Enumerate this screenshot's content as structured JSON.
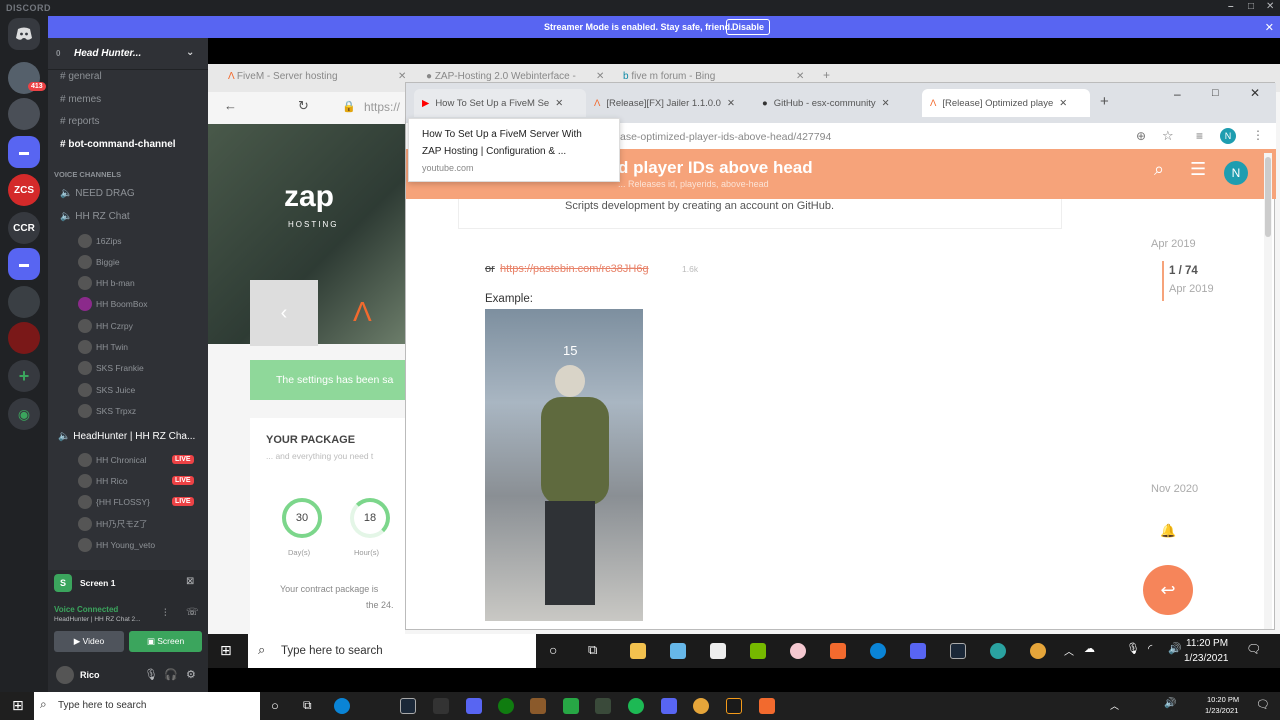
{
  "discord": {
    "app_title": "DISCORD",
    "streamer_message": "Streamer Mode is enabled. Stay safe, friend.",
    "streamer_disable": "Disable",
    "guild_badge": "413",
    "guild_ccr": "CCR",
    "server_name": "Head Hunter...",
    "server_count": "0",
    "text_channels": [
      "general",
      "memes",
      "reports",
      "bot-command-channel"
    ],
    "voice_header": "VOICE CHANNELS",
    "voice_channels": {
      "need_drag": "NEED DRAG",
      "hh_rz_chat": "HH RZ Chat",
      "hh_rz_users": [
        "16Zips",
        "Biggie",
        "HH b-man",
        "HH BoomBox",
        "HH Czrpy",
        "HH Twin",
        "SKS Frankie",
        "SKS Juice",
        "SKS Trpxz"
      ],
      "headhunter_channel": "HeadHunter | HH RZ Cha...",
      "headhunter_users": [
        "HH Chronical",
        "HH Rico",
        "{HH FLOSSY}",
        "HH乃尺モZ了",
        "HH Young_veto"
      ],
      "live_label": "LIVE"
    },
    "screen_share_label": "Screen 1",
    "voice_status": "Voice Connected",
    "voice_channel_short": "HeadHunter | HH RZ Chat 2...",
    "video_button": "Video",
    "screen_button": "Screen",
    "username": "Rico"
  },
  "browser_bg": {
    "tabs": [
      "FiveM - Server hosting",
      "ZAP-Hosting 2.0 Webinterface -",
      "five m forum - Bing"
    ],
    "address_partial": "https://",
    "notice": "The settings has been sa",
    "package_title": "YOUR PACKAGE",
    "package_sub": "... and everything you need t",
    "days_value": "30",
    "days_label": "Day(s)",
    "hours_value": "18",
    "hours_label": "Hour(s)",
    "contract_text_1": "Your contract package is",
    "contract_text_2": "the 24."
  },
  "browser_fg": {
    "tabs": [
      "How To Set Up a FiveM Se",
      "[Release][FX] Jailer 1.1.0.0",
      "GitHub - esx-community",
      "[Release] Optimized playe"
    ],
    "url": "ase-optimized-player-ids-above-head/427794",
    "profile_initial": "N",
    "topic_title": "d player IDs above head",
    "breadcrumb": "... Releases  id, playerids, above-head",
    "github_text": "Scripts development by creating an account on GitHub.",
    "pastebin_prefix": "or",
    "pastebin_link": "https://pastebin.com/rc38JH6g",
    "pastebin_count": "1.6k",
    "example_label": "Example:",
    "image_id": "15",
    "timeline_start": "Apr 2019",
    "timeline_progress": "1 / 74",
    "timeline_progress_date": "Apr 2019",
    "timeline_end": "Nov 2020"
  },
  "tooltip": {
    "title_line1": "How To Set Up a FiveM Server With",
    "title_line2": "ZAP Hosting | Configuration & ...",
    "domain": "youtube.com"
  },
  "taskbar_inner": {
    "search_placeholder": "Type here to search",
    "time": "11:20 PM",
    "date": "1/23/2021"
  },
  "taskbar_outer": {
    "search_placeholder": "Type here to search",
    "time": "10:20 PM",
    "date": "1/23/2021"
  },
  "colors": {
    "discord_blurple": "#5865f2",
    "live_red": "#ed4245",
    "voice_green": "#3ba55d",
    "discourse_orange": "#f6a37a"
  }
}
